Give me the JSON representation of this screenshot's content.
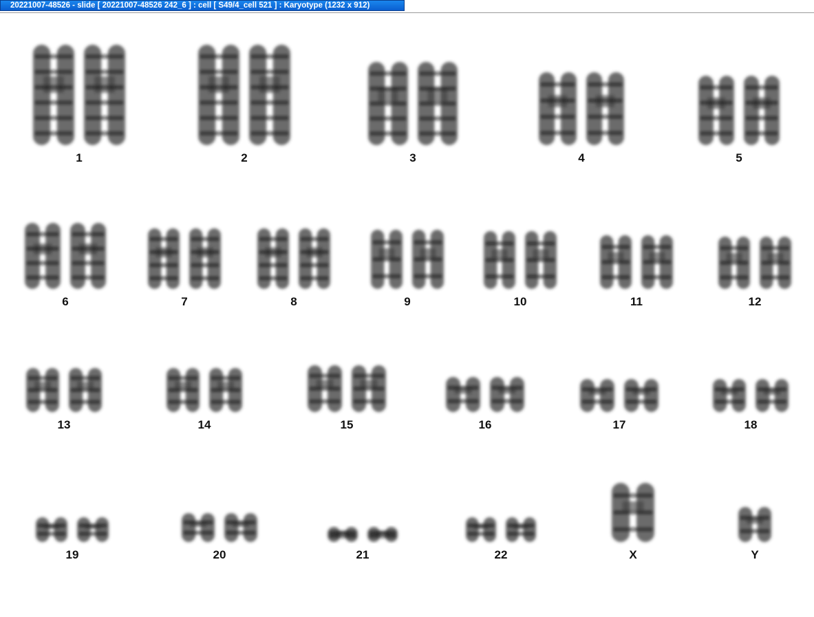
{
  "window": {
    "title": "20221007-48526 - slide [ 20221007-48526 242_6 ] : cell [ S49/4_cell 521 ] : Karyotype  (1232 x 912)"
  },
  "karyotype": {
    "labels": [
      "1",
      "2",
      "3",
      "4",
      "5",
      "6",
      "7",
      "8",
      "9",
      "10",
      "11",
      "12",
      "13",
      "14",
      "15",
      "16",
      "17",
      "18",
      "19",
      "20",
      "21",
      "22",
      "X",
      "Y"
    ]
  },
  "colors": {
    "title_bar": "#0a5fd0",
    "chromosome": "#3a3a3a",
    "band": "#111111"
  }
}
